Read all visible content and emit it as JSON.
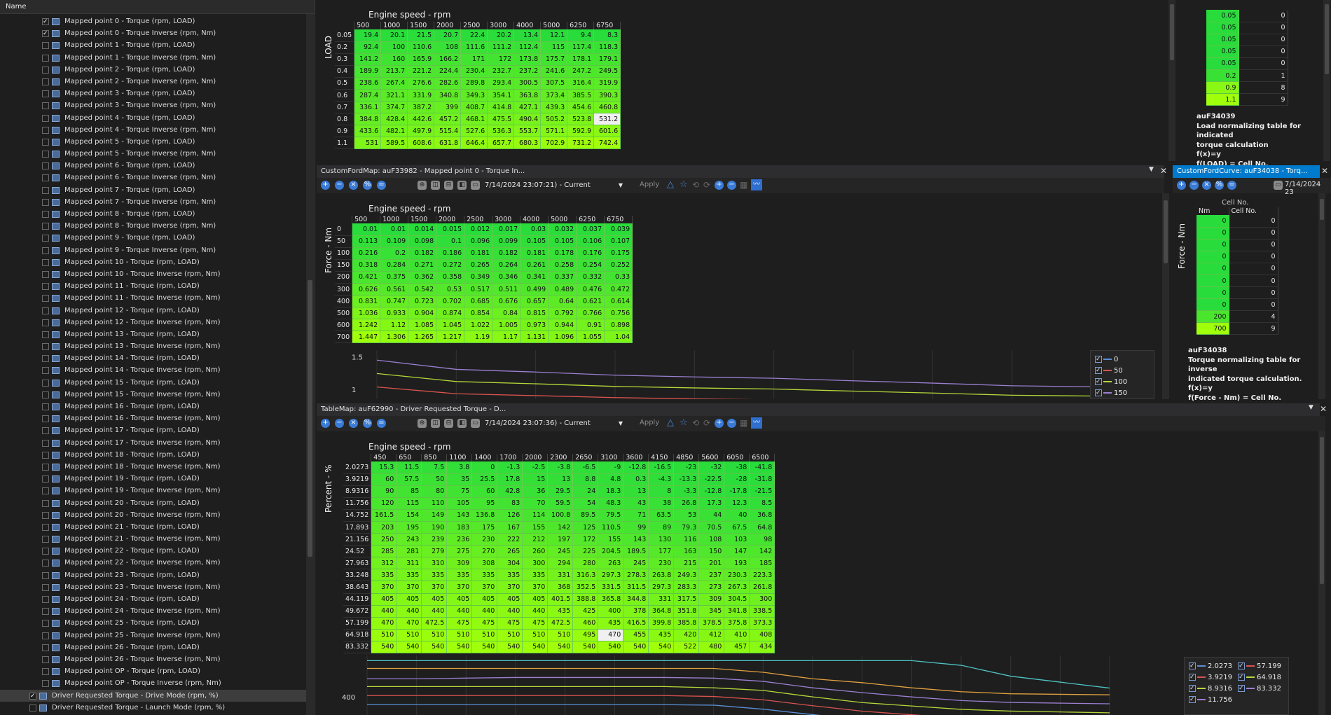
{
  "tree": {
    "header": "Name",
    "items": [
      {
        "label": "Mapped point  0 - Torque (rpm, LOAD)",
        "checked": true
      },
      {
        "label": "Mapped point  0 - Torque Inverse (rpm, Nm)",
        "checked": true
      },
      {
        "label": "Mapped point  1 - Torque (rpm, LOAD)",
        "checked": false
      },
      {
        "label": "Mapped point  1 - Torque Inverse (rpm, Nm)",
        "checked": false
      },
      {
        "label": "Mapped point  2 - Torque (rpm, LOAD)",
        "checked": false
      },
      {
        "label": "Mapped point  2 - Torque Inverse (rpm, Nm)",
        "checked": false
      },
      {
        "label": "Mapped point  3 - Torque (rpm, LOAD)",
        "checked": false
      },
      {
        "label": "Mapped point  3 - Torque Inverse (rpm, Nm)",
        "checked": false
      },
      {
        "label": "Mapped point  4 - Torque (rpm, LOAD)",
        "checked": false
      },
      {
        "label": "Mapped point  4 - Torque Inverse (rpm, Nm)",
        "checked": false
      },
      {
        "label": "Mapped point  5 - Torque (rpm, LOAD)",
        "checked": false
      },
      {
        "label": "Mapped point  5 - Torque Inverse (rpm, Nm)",
        "checked": false
      },
      {
        "label": "Mapped point  6 - Torque (rpm, LOAD)",
        "checked": false
      },
      {
        "label": "Mapped point  6 - Torque Inverse (rpm, Nm)",
        "checked": false
      },
      {
        "label": "Mapped point  7 - Torque (rpm, LOAD)",
        "checked": false
      },
      {
        "label": "Mapped point  7 - Torque Inverse (rpm, Nm)",
        "checked": false
      },
      {
        "label": "Mapped point  8 - Torque (rpm, LOAD)",
        "checked": false
      },
      {
        "label": "Mapped point  8 - Torque Inverse (rpm, Nm)",
        "checked": false
      },
      {
        "label": "Mapped point  9 - Torque (rpm, LOAD)",
        "checked": false
      },
      {
        "label": "Mapped point  9 - Torque Inverse (rpm, Nm)",
        "checked": false
      },
      {
        "label": "Mapped point 10 - Torque (rpm, LOAD)",
        "checked": false
      },
      {
        "label": "Mapped point 10 - Torque Inverse (rpm, Nm)",
        "checked": false
      },
      {
        "label": "Mapped point 11 - Torque (rpm, LOAD)",
        "checked": false
      },
      {
        "label": "Mapped point 11 - Torque Inverse (rpm, Nm)",
        "checked": false
      },
      {
        "label": "Mapped point 12 - Torque (rpm, LOAD)",
        "checked": false
      },
      {
        "label": "Mapped point 12 - Torque Inverse (rpm, Nm)",
        "checked": false
      },
      {
        "label": "Mapped point 13 - Torque (rpm, LOAD)",
        "checked": false
      },
      {
        "label": "Mapped point 13 - Torque Inverse (rpm, Nm)",
        "checked": false
      },
      {
        "label": "Mapped point 14 - Torque (rpm, LOAD)",
        "checked": false
      },
      {
        "label": "Mapped point 14 - Torque Inverse (rpm, Nm)",
        "checked": false
      },
      {
        "label": "Mapped point 15 - Torque (rpm, LOAD)",
        "checked": false
      },
      {
        "label": "Mapped point 15 - Torque Inverse (rpm, Nm)",
        "checked": false
      },
      {
        "label": "Mapped point 16 - Torque (rpm, LOAD)",
        "checked": false
      },
      {
        "label": "Mapped point 16 - Torque Inverse (rpm, Nm)",
        "checked": false
      },
      {
        "label": "Mapped point 17 - Torque (rpm, LOAD)",
        "checked": false
      },
      {
        "label": "Mapped point 17 - Torque Inverse (rpm, Nm)",
        "checked": false
      },
      {
        "label": "Mapped point 18 - Torque (rpm, LOAD)",
        "checked": false
      },
      {
        "label": "Mapped point 18 - Torque Inverse (rpm, Nm)",
        "checked": false
      },
      {
        "label": "Mapped point 19 - Torque (rpm, LOAD)",
        "checked": false
      },
      {
        "label": "Mapped point 19 - Torque Inverse (rpm, Nm)",
        "checked": false
      },
      {
        "label": "Mapped point 20 - Torque (rpm, LOAD)",
        "checked": false
      },
      {
        "label": "Mapped point 20 - Torque Inverse (rpm, Nm)",
        "checked": false
      },
      {
        "label": "Mapped point 21 - Torque (rpm, LOAD)",
        "checked": false
      },
      {
        "label": "Mapped point 21 - Torque Inverse (rpm, Nm)",
        "checked": false
      },
      {
        "label": "Mapped point 22 - Torque (rpm, LOAD)",
        "checked": false
      },
      {
        "label": "Mapped point 22 - Torque Inverse (rpm, Nm)",
        "checked": false
      },
      {
        "label": "Mapped point 23 - Torque (rpm, LOAD)",
        "checked": false
      },
      {
        "label": "Mapped point 23 - Torque Inverse (rpm, Nm)",
        "checked": false
      },
      {
        "label": "Mapped point 24 - Torque (rpm, LOAD)",
        "checked": false
      },
      {
        "label": "Mapped point 24 - Torque Inverse (rpm, Nm)",
        "checked": false
      },
      {
        "label": "Mapped point 25 - Torque (rpm, LOAD)",
        "checked": false
      },
      {
        "label": "Mapped point 25 - Torque Inverse (rpm, Nm)",
        "checked": false
      },
      {
        "label": "Mapped point 26 - Torque (rpm, LOAD)",
        "checked": false
      },
      {
        "label": "Mapped point 26 - Torque Inverse (rpm, Nm)",
        "checked": false
      },
      {
        "label": "Mapped point OP - Torque (rpm, LOAD)",
        "checked": false
      },
      {
        "label": "Mapped point OP - Torque Inverse (rpm, Nm)",
        "checked": false
      },
      {
        "label": "Driver Requested Torque - Drive Mode (rpm, %)",
        "checked": true,
        "selected": true,
        "level": 0
      },
      {
        "label": "Driver Requested Torque - Launch Mode (rpm, %)",
        "checked": false,
        "level": 0
      }
    ]
  },
  "top_panel": {
    "title": "Engine speed - rpm",
    "ylabel": "LOAD",
    "cols": [
      "500",
      "1000",
      "1500",
      "2000",
      "2500",
      "3000",
      "4000",
      "5000",
      "6250",
      "6750"
    ],
    "rows": [
      {
        "h": "0.05",
        "v": [
          "19.4",
          "20.1",
          "21.5",
          "20.7",
          "22.4",
          "20.2",
          "13.4",
          "12.1",
          "9.4",
          "8.3"
        ]
      },
      {
        "h": "0.2",
        "v": [
          "92.4",
          "100",
          "110.6",
          "108",
          "111.6",
          "111.2",
          "112.4",
          "115",
          "117.4",
          "118.3"
        ]
      },
      {
        "h": "0.3",
        "v": [
          "141.2",
          "160",
          "165.9",
          "166.2",
          "171",
          "172",
          "173.8",
          "175.7",
          "178.1",
          "179.1"
        ]
      },
      {
        "h": "0.4",
        "v": [
          "189.9",
          "213.7",
          "221.2",
          "224.4",
          "230.4",
          "232.7",
          "237.2",
          "241.6",
          "247.2",
          "249.5"
        ]
      },
      {
        "h": "0.5",
        "v": [
          "238.6",
          "267.4",
          "276.6",
          "282.6",
          "289.8",
          "293.4",
          "300.5",
          "307.5",
          "316.4",
          "319.9"
        ]
      },
      {
        "h": "0.6",
        "v": [
          "287.4",
          "321.1",
          "331.9",
          "340.8",
          "349.3",
          "354.1",
          "363.8",
          "373.4",
          "385.5",
          "390.3"
        ]
      },
      {
        "h": "0.7",
        "v": [
          "336.1",
          "374.7",
          "387.2",
          "399",
          "408.7",
          "414.8",
          "427.1",
          "439.3",
          "454.6",
          "460.8"
        ]
      },
      {
        "h": "0.8",
        "v": [
          "384.8",
          "428.4",
          "442.6",
          "457.2",
          "468.1",
          "475.5",
          "490.4",
          "505.2",
          "523.8",
          "531.2"
        ]
      },
      {
        "h": "0.9",
        "v": [
          "433.6",
          "482.1",
          "497.9",
          "515.4",
          "527.6",
          "536.3",
          "553.7",
          "571.1",
          "592.9",
          "601.6"
        ]
      },
      {
        "h": "1.1",
        "v": [
          "531",
          "589.5",
          "608.6",
          "631.8",
          "646.4",
          "657.7",
          "680.3",
          "702.9",
          "731.2",
          "742.4"
        ]
      }
    ]
  },
  "right_top": {
    "cells": [
      [
        "0.05",
        "0"
      ],
      [
        "0.05",
        "0"
      ],
      [
        "0.05",
        "0"
      ],
      [
        "0.05",
        "0"
      ],
      [
        "0.05",
        "0"
      ],
      [
        "0.2",
        "1"
      ],
      [
        "0.9",
        "8"
      ],
      [
        "1.1",
        "9"
      ]
    ],
    "desc": [
      "auF34039",
      "Load normalizing table for indicated",
      "torque calculation",
      "f(x)=y",
      "f(LOAD) = Cell No."
    ]
  },
  "mid_panel": {
    "tab": "CustomFordMap: auF33982 - Mapped point  0 - Torque In...",
    "date": "7/14/2024 23:07:21) - Current",
    "apply": "Apply",
    "title": "Engine speed - rpm",
    "ylabel": "Force - Nm",
    "cols": [
      "500",
      "1000",
      "1500",
      "2000",
      "2500",
      "3000",
      "4000",
      "5000",
      "6250",
      "6750"
    ],
    "rows": [
      {
        "h": "0",
        "v": [
          "0.01",
          "0.01",
          "0.014",
          "0.015",
          "0.012",
          "0.017",
          "0.03",
          "0.032",
          "0.037",
          "0.039"
        ]
      },
      {
        "h": "50",
        "v": [
          "0.113",
          "0.109",
          "0.098",
          "0.1",
          "0.096",
          "0.099",
          "0.105",
          "0.105",
          "0.106",
          "0.107"
        ]
      },
      {
        "h": "100",
        "v": [
          "0.216",
          "0.2",
          "0.182",
          "0.186",
          "0.181",
          "0.182",
          "0.181",
          "0.178",
          "0.176",
          "0.175"
        ]
      },
      {
        "h": "150",
        "v": [
          "0.318",
          "0.284",
          "0.271",
          "0.272",
          "0.265",
          "0.264",
          "0.261",
          "0.258",
          "0.254",
          "0.252"
        ]
      },
      {
        "h": "200",
        "v": [
          "0.421",
          "0.375",
          "0.362",
          "0.358",
          "0.349",
          "0.346",
          "0.341",
          "0.337",
          "0.332",
          "0.33"
        ]
      },
      {
        "h": "300",
        "v": [
          "0.626",
          "0.561",
          "0.542",
          "0.53",
          "0.517",
          "0.511",
          "0.499",
          "0.489",
          "0.476",
          "0.472"
        ]
      },
      {
        "h": "400",
        "v": [
          "0.831",
          "0.747",
          "0.723",
          "0.702",
          "0.685",
          "0.676",
          "0.657",
          "0.64",
          "0.621",
          "0.614"
        ]
      },
      {
        "h": "500",
        "v": [
          "1.036",
          "0.933",
          "0.904",
          "0.874",
          "0.854",
          "0.84",
          "0.815",
          "0.792",
          "0.766",
          "0.756"
        ]
      },
      {
        "h": "600",
        "v": [
          "1.242",
          "1.12",
          "1.085",
          "1.045",
          "1.022",
          "1.005",
          "0.973",
          "0.944",
          "0.91",
          "0.898"
        ]
      },
      {
        "h": "700",
        "v": [
          "1.447",
          "1.306",
          "1.265",
          "1.217",
          "1.19",
          "1.17",
          "1.131",
          "1.096",
          "1.055",
          "1.04"
        ]
      }
    ],
    "chart_ticks": [
      "1.5",
      "1"
    ],
    "legend": [
      {
        "label": "0",
        "color": "#5b8fd6"
      },
      {
        "label": "50",
        "color": "#d9534f"
      },
      {
        "label": "100",
        "color": "#b5d83a"
      },
      {
        "label": "150",
        "color": "#9b7fd1"
      }
    ]
  },
  "right_mid": {
    "tab": "CustomFordCurve: auF34038 - Torq...",
    "date": "7/14/2024 23",
    "col_nm": "Nm",
    "col_cell": "Cell No.",
    "partial_header": "Cell No.",
    "ylabel": "Force - Nm",
    "cells": [
      [
        "0",
        "0"
      ],
      [
        "0",
        "0"
      ],
      [
        "0",
        "0"
      ],
      [
        "0",
        "0"
      ],
      [
        "0",
        "0"
      ],
      [
        "0",
        "0"
      ],
      [
        "0",
        "0"
      ],
      [
        "0",
        "0"
      ],
      [
        "200",
        "4"
      ],
      [
        "700",
        "9"
      ]
    ],
    "desc": [
      "auF34038",
      "Torque normalizing table for inverse",
      "indicated torque calculation.",
      "f(x)=y",
      "f(Force - Nm) = Cell No."
    ]
  },
  "bottom_panel": {
    "tab": "TableMap: auF62990 - Driver Requested Torque - D...",
    "date": "7/14/2024 23:07:36) - Current",
    "apply": "Apply",
    "title": "Engine speed - rpm",
    "ylabel": "Percent - %",
    "cols": [
      "450",
      "650",
      "850",
      "1100",
      "1400",
      "1700",
      "2000",
      "2300",
      "2650",
      "3100",
      "3600",
      "4150",
      "4850",
      "5600",
      "6050",
      "6500"
    ],
    "rows": [
      {
        "h": "2.0273",
        "v": [
          "15.3",
          "11.5",
          "7.5",
          "3.8",
          "0",
          "-1.3",
          "-2.5",
          "-3.8",
          "-6.5",
          "-9",
          "-12.8",
          "-16.5",
          "-23",
          "-32",
          "-38",
          "-41.8"
        ]
      },
      {
        "h": "3.9219",
        "v": [
          "60",
          "57.5",
          "50",
          "35",
          "25.5",
          "17.8",
          "15",
          "13",
          "8.8",
          "4.8",
          "0.3",
          "-4.3",
          "-13.3",
          "-22.5",
          "-28",
          "-31.8"
        ]
      },
      {
        "h": "8.9316",
        "v": [
          "90",
          "85",
          "80",
          "75",
          "60",
          "42.8",
          "36",
          "29.5",
          "24",
          "18.3",
          "13",
          "8",
          "-3.3",
          "-12.8",
          "-17.8",
          "-21.5"
        ]
      },
      {
        "h": "11.756",
        "v": [
          "120",
          "115",
          "110",
          "105",
          "95",
          "83",
          "70",
          "59.5",
          "54",
          "48.3",
          "43",
          "38",
          "26.8",
          "17.3",
          "12.3",
          "8.5"
        ]
      },
      {
        "h": "14.752",
        "v": [
          "161.5",
          "154",
          "149",
          "143",
          "136.8",
          "126",
          "114",
          "100.8",
          "89.5",
          "79.5",
          "71",
          "63.5",
          "53",
          "44",
          "40",
          "36.8"
        ]
      },
      {
        "h": "17.893",
        "v": [
          "203",
          "195",
          "190",
          "183",
          "175",
          "167",
          "155",
          "142",
          "125",
          "110.5",
          "99",
          "89",
          "79.3",
          "70.5",
          "67.5",
          "64.8"
        ]
      },
      {
        "h": "21.156",
        "v": [
          "250",
          "243",
          "239",
          "236",
          "230",
          "222",
          "212",
          "197",
          "172",
          "155",
          "143",
          "130",
          "116",
          "108",
          "103",
          "98"
        ]
      },
      {
        "h": "24.52",
        "v": [
          "285",
          "281",
          "279",
          "275",
          "270",
          "265",
          "260",
          "245",
          "225",
          "204.5",
          "189.5",
          "177",
          "163",
          "150",
          "147",
          "142"
        ]
      },
      {
        "h": "27.963",
        "v": [
          "312",
          "311",
          "310",
          "309",
          "308",
          "304",
          "300",
          "294",
          "280",
          "263",
          "245",
          "230",
          "215",
          "201",
          "193",
          "185"
        ]
      },
      {
        "h": "33.248",
        "v": [
          "335",
          "335",
          "335",
          "335",
          "335",
          "335",
          "335",
          "331",
          "316.3",
          "297.3",
          "278.3",
          "263.8",
          "249.3",
          "237",
          "230.3",
          "223.3"
        ]
      },
      {
        "h": "38.643",
        "v": [
          "370",
          "370",
          "370",
          "370",
          "370",
          "370",
          "370",
          "368",
          "352.5",
          "331.5",
          "311.5",
          "297.3",
          "283.3",
          "273",
          "267.3",
          "261.8"
        ]
      },
      {
        "h": "44.119",
        "v": [
          "405",
          "405",
          "405",
          "405",
          "405",
          "405",
          "405",
          "401.5",
          "388.8",
          "365.8",
          "344.8",
          "331",
          "317.5",
          "309",
          "304.5",
          "300"
        ]
      },
      {
        "h": "49.672",
        "v": [
          "440",
          "440",
          "440",
          "440",
          "440",
          "440",
          "440",
          "435",
          "425",
          "400",
          "378",
          "364.8",
          "351.8",
          "345",
          "341.8",
          "338.5"
        ]
      },
      {
        "h": "57.199",
        "v": [
          "470",
          "470",
          "472.5",
          "475",
          "475",
          "475",
          "475",
          "472.5",
          "460",
          "435",
          "416.5",
          "399.8",
          "385.8",
          "378.5",
          "375.8",
          "373.3"
        ]
      },
      {
        "h": "64.918",
        "v": [
          "510",
          "510",
          "510",
          "510",
          "510",
          "510",
          "510",
          "510",
          "495",
          "470",
          "455",
          "435",
          "420",
          "412",
          "410",
          "408"
        ]
      },
      {
        "h": "83.332",
        "v": [
          "540",
          "540",
          "540",
          "540",
          "540",
          "540",
          "540",
          "540",
          "540",
          "540",
          "540",
          "540",
          "522",
          "480",
          "457",
          "434"
        ]
      }
    ],
    "chart_ticks": [
      "400"
    ],
    "legend": [
      {
        "label": "2.0273",
        "color": "#5b8fd6"
      },
      {
        "label": "57.199",
        "color": "#d9534f"
      },
      {
        "label": "3.9219",
        "color": "#d9534f"
      },
      {
        "label": "64.918",
        "color": "#b5d83a"
      },
      {
        "label": "8.9316",
        "color": "#b5d83a"
      },
      {
        "label": "83.332",
        "color": "#9b7fd1"
      },
      {
        "label": "11.756",
        "color": "#9b7fd1"
      }
    ]
  }
}
